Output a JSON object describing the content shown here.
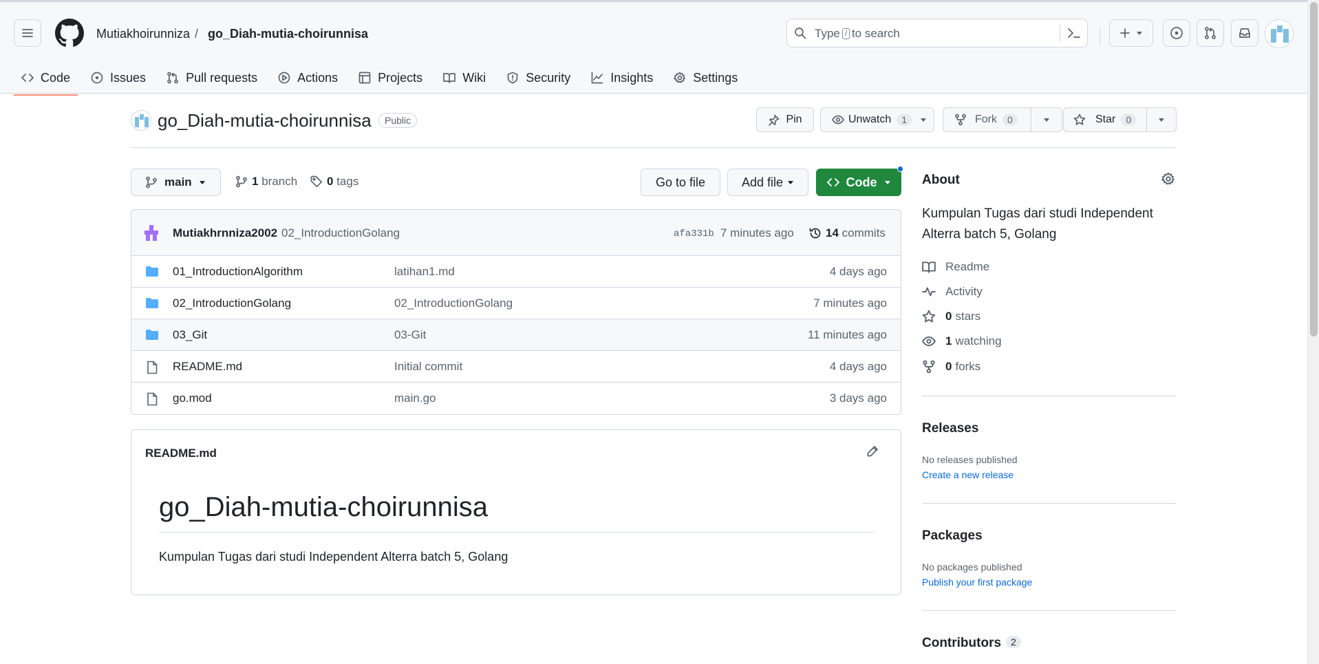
{
  "header": {
    "owner": "Mutiakhoirunniza",
    "separator": "/",
    "repo": "go_Diah-mutia-choirunnisa",
    "search_prefix": "Type",
    "search_key": "/",
    "search_suffix": "to search"
  },
  "tabs": [
    {
      "label": "Code",
      "icon": "code-icon",
      "active": true
    },
    {
      "label": "Issues",
      "icon": "issue-icon"
    },
    {
      "label": "Pull requests",
      "icon": "pull-request-icon"
    },
    {
      "label": "Actions",
      "icon": "play-icon"
    },
    {
      "label": "Projects",
      "icon": "table-icon"
    },
    {
      "label": "Wiki",
      "icon": "book-icon"
    },
    {
      "label": "Security",
      "icon": "shield-icon"
    },
    {
      "label": "Insights",
      "icon": "graph-icon"
    },
    {
      "label": "Settings",
      "icon": "gear-icon"
    }
  ],
  "repo": {
    "title": "go_Diah-mutia-choirunnisa",
    "visibility": "Public",
    "pin_label": "Pin",
    "unwatch_label": "Unwatch",
    "watch_count": "1",
    "fork_label": "Fork",
    "fork_count": "0",
    "star_label": "Star",
    "star_count": "0"
  },
  "branch_bar": {
    "branch": "main",
    "branch_count": "1",
    "branch_word": "branch",
    "tag_count": "0",
    "tag_word": "tags",
    "go_to_file": "Go to file",
    "add_file": "Add file",
    "code_label": "Code"
  },
  "commit": {
    "author": "Mutiakhrnniza2002",
    "message": "02_IntroductionGolang",
    "sha": "afa331b",
    "time": "7 minutes ago",
    "count": "14",
    "count_word": "commits"
  },
  "files": [
    {
      "name": "01_IntroductionAlgorithm",
      "type": "folder",
      "message": "latihan1.md",
      "time": "4 days ago"
    },
    {
      "name": "02_IntroductionGolang",
      "type": "folder",
      "message": "02_IntroductionGolang",
      "time": "7 minutes ago"
    },
    {
      "name": "03_Git",
      "type": "folder",
      "message": "03-Git",
      "time": "11 minutes ago"
    },
    {
      "name": "README.md",
      "type": "file",
      "message": "Initial commit",
      "time": "4 days ago"
    },
    {
      "name": "go.mod",
      "type": "file",
      "message": "main.go",
      "time": "3 days ago"
    }
  ],
  "readme": {
    "label": "README.md",
    "heading": "go_Diah-mutia-choirunnisa",
    "body": "Kumpulan Tugas dari studi Independent Alterra batch 5, Golang"
  },
  "about": {
    "title": "About",
    "description": "Kumpulan Tugas dari studi Independent Alterra batch 5, Golang",
    "readme": "Readme",
    "activity": "Activity",
    "stars_count": "0",
    "stars_word": "stars",
    "watching_count": "1",
    "watching_word": "watching",
    "forks_count": "0",
    "forks_word": "forks"
  },
  "releases": {
    "title": "Releases",
    "note": "No releases published",
    "link": "Create a new release"
  },
  "packages": {
    "title": "Packages",
    "note": "No packages published",
    "link": "Publish your first package"
  },
  "contributors": {
    "title": "Contributors",
    "count": "2"
  },
  "colors": {
    "accent": "#1f883d",
    "link": "#0969da",
    "folder": "#54aeff",
    "tab_underline": "#fd8c73"
  }
}
